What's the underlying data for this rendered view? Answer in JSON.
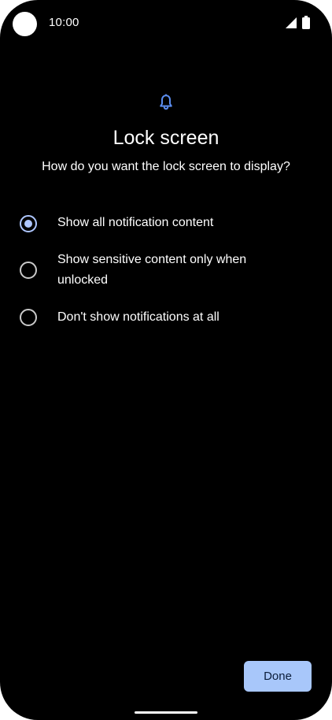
{
  "status_bar": {
    "time": "10:00",
    "icons": [
      "signal-icon",
      "battery-icon"
    ]
  },
  "header": {
    "icon": "bell-icon",
    "title": "Lock screen",
    "subtitle": "How do you want the lock screen to display?"
  },
  "options": [
    {
      "label": "Show all notification content",
      "selected": true
    },
    {
      "label": "Show sensitive content only when unlocked",
      "selected": false
    },
    {
      "label": "Don't show notifications at all",
      "selected": false
    }
  ],
  "footer": {
    "done_label": "Done"
  },
  "colors": {
    "background": "#000000",
    "accent": "#aec6ff",
    "button_bg": "#a8c7fa",
    "bell": "#5b8def"
  }
}
